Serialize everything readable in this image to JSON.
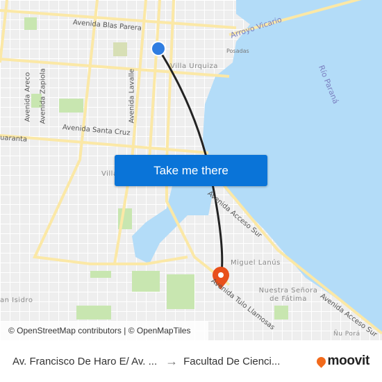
{
  "map": {
    "labels": {
      "blas_parera": "Avenida Blas Parera",
      "arroyo_vicario": "Arroyo Vicario",
      "rio_parana": "Río Paraná",
      "posadas": "Posadas",
      "villa_urquiza": "Villa Urquiza",
      "areco": "Avenida Areco",
      "zapiola": "Avenida Zapiola",
      "lavalle": "Avenida Lavalle",
      "santa_cruz": "Avenida Santa Cruz",
      "cuaranta": "uaranta",
      "villa": "Villa",
      "acceso_sur_1": "Avenida Acceso Sur",
      "acceso_sur_2": "Avenida Acceso Sur",
      "miguel_lanus": "Miguel Lanús",
      "fatima": "Nuestra Señora de Fátima",
      "tulo": "Avenida Tulo Llamosas",
      "san_isidro": "an Isidro",
      "nu_pora": "Ñu Porá"
    },
    "colors": {
      "water": "#b3dcf8",
      "route": "#222222",
      "origin": "#2f7de1",
      "destination": "#e8501a",
      "road": "#fbe8a6",
      "park": "#c8e6b0"
    }
  },
  "cta": {
    "label": "Take me there"
  },
  "attribution": "© OpenStreetMap contributors | © OpenMapTiles",
  "footer": {
    "origin": "Av. Francisco De Haro E/ Av. ...",
    "arrow": "→",
    "destination": "Facultad De Cienci...",
    "brand": "moovit"
  }
}
